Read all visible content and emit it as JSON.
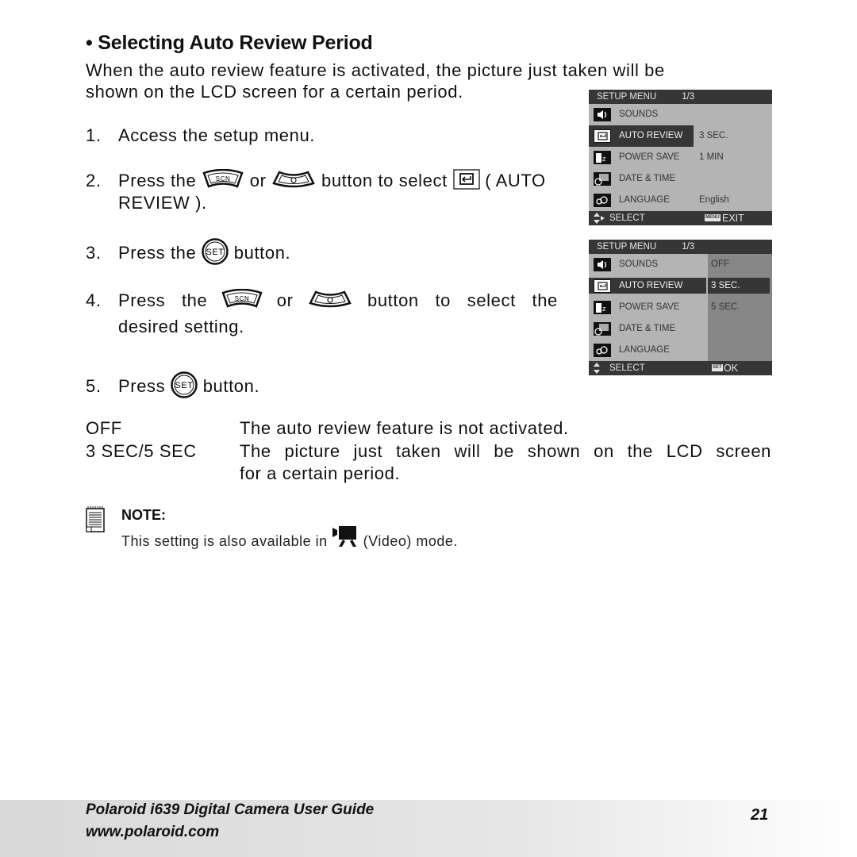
{
  "section": {
    "title": "• Selecting Auto Review Period",
    "intro_line1": "When the auto review feature is activated, the picture just taken will be",
    "intro_line2": "shown on the LCD screen for a certain period."
  },
  "steps": [
    {
      "num": "1.",
      "text": "Access the setup menu."
    },
    {
      "num": "2.",
      "pre": "Press the",
      "or": "or",
      "post": "button to select",
      "tail": "( AUTO",
      "line2": "REVIEW )."
    },
    {
      "num": "3.",
      "pre": "Press the",
      "post": "button."
    },
    {
      "num": "4.",
      "pre": "Press the",
      "or": "or",
      "post": "button to select the",
      "line2": "desired setting."
    },
    {
      "num": "5.",
      "pre": "Press",
      "post": "button."
    }
  ],
  "button_labels": {
    "scn": "SCN",
    "set": "SET"
  },
  "definitions": [
    {
      "term": "OFF",
      "desc": "The auto review feature is not activated."
    },
    {
      "term": "3 SEC/5 SEC",
      "desc": "The picture just taken will be shown on the LCD screen",
      "desc2": "for a certain period."
    }
  ],
  "note": {
    "title": "NOTE:",
    "pre": "This setting is also available in",
    "post": "(Video) mode."
  },
  "lcd1": {
    "header": "SETUP MENU",
    "page": "1/3",
    "rows": [
      {
        "label": "SOUNDS",
        "value": ""
      },
      {
        "label": "AUTO REVIEW",
        "value": "3 SEC."
      },
      {
        "label": "POWER SAVE",
        "value": "1 MIN"
      },
      {
        "label": "DATE & TIME",
        "value": ""
      },
      {
        "label": "LANGUAGE",
        "value": "English"
      }
    ],
    "footer_left": "SELECT",
    "footer_key": "MENU",
    "footer_right": "EXIT"
  },
  "lcd2": {
    "header": "SETUP MENU",
    "page": "1/3",
    "rows": [
      {
        "label": "SOUNDS",
        "value": "OFF"
      },
      {
        "label": "AUTO REVIEW",
        "value": "3 SEC."
      },
      {
        "label": "POWER SAVE",
        "value": "5 SEC."
      },
      {
        "label": "DATE & TIME",
        "value": ""
      },
      {
        "label": "LANGUAGE",
        "value": ""
      }
    ],
    "footer_left": "SELECT",
    "footer_key": "SET",
    "footer_right": "OK"
  },
  "footer": {
    "guide_title": "Polaroid i639 Digital Camera User Guide",
    "website": "www.polaroid.com",
    "page_number": "21"
  }
}
